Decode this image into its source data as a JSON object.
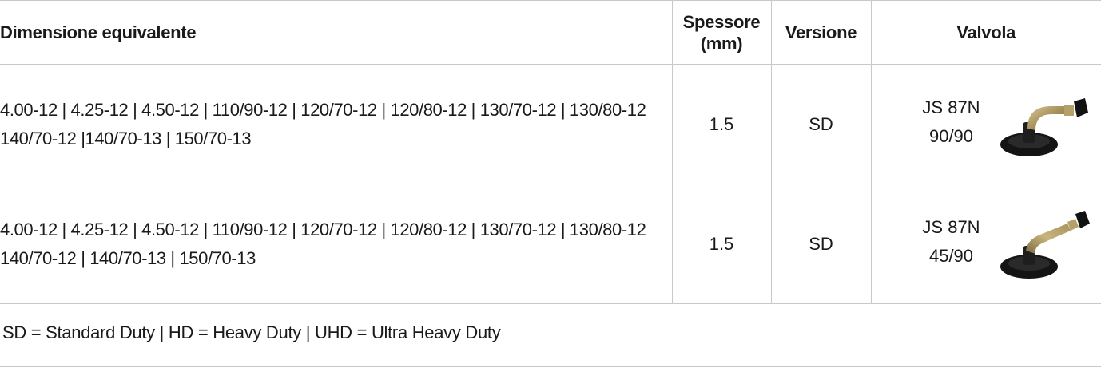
{
  "table": {
    "headers": {
      "dimension": "Dimensione equivalente",
      "thickness_line1": "Spessore",
      "thickness_line2": "(mm)",
      "version": "Versione",
      "valve": "Valvola"
    },
    "rows": [
      {
        "dimension_line1": "4.00-12 | 4.25-12 | 4.50-12 | 110/90-12 | 120/70-12 | 120/80-12 | 130/70-12 | 130/80-12",
        "dimension_line2": "140/70-12 |140/70-13 | 150/70-13",
        "thickness": "1.5",
        "version": "SD",
        "valve_line1": "JS 87N",
        "valve_line2": "90/90",
        "valve_icon": "valve-90-degree-icon"
      },
      {
        "dimension_line1": "4.00-12 | 4.25-12 | 4.50-12 | 110/90-12 | 120/70-12 | 120/80-12 | 130/70-12 | 130/80-12",
        "dimension_line2": "140/70-12 | 140/70-13 | 150/70-13",
        "thickness": "1.5",
        "version": "SD",
        "valve_line1": "JS 87N",
        "valve_line2": "45/90",
        "valve_icon": "valve-45-degree-icon"
      }
    ]
  },
  "legend": "SD = Standard Duty | HD = Heavy Duty | UHD = Ultra Heavy Duty"
}
